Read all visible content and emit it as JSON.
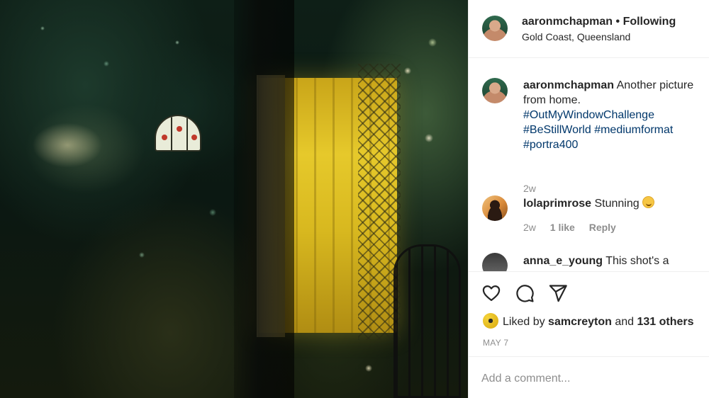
{
  "post": {
    "username": "aaronmchapman",
    "separator": "•",
    "follow_status": "Following",
    "location": "Gold Coast, Queensland"
  },
  "caption": {
    "username": "aaronmchapman",
    "text": "Another picture from home.",
    "hashtags": [
      "#OutMyWindowChallenge",
      "#BeStillWorld",
      "#mediumformat",
      "#portra400"
    ],
    "time": "2w"
  },
  "comments": [
    {
      "username": "lolaprimrose",
      "text": "Stunning",
      "emoji": "slightly-smiling-face",
      "time": "2w",
      "likes": "1 like",
      "reply_label": "Reply"
    },
    {
      "username": "anna_e_young",
      "text": "This shot's a"
    }
  ],
  "actions": {
    "like_icon": "heart-icon",
    "comment_icon": "comment-bubble-icon",
    "share_icon": "paper-plane-icon"
  },
  "likes": {
    "prefix": "Liked by",
    "user": "samcreyton",
    "joiner": "and",
    "others": "131 others"
  },
  "date": "MAY 7",
  "add_comment": {
    "placeholder": "Add a comment..."
  }
}
